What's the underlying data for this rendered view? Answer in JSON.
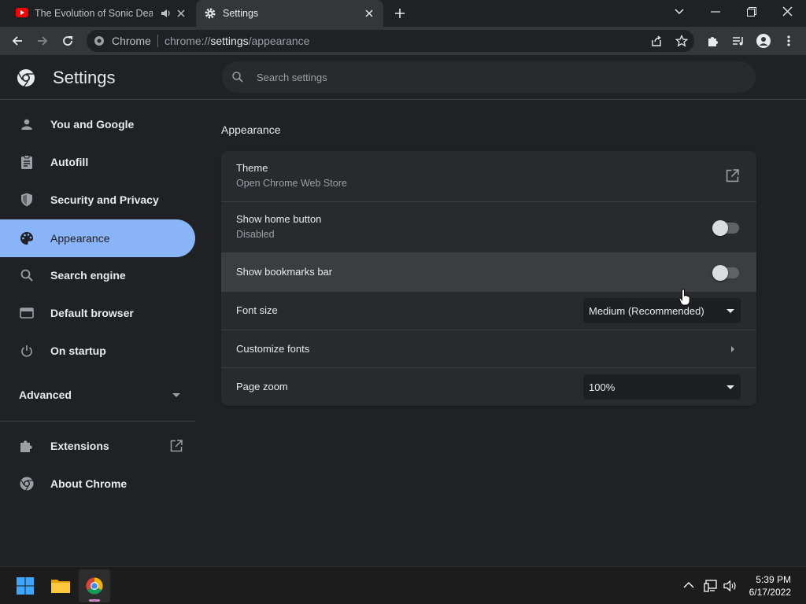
{
  "tabs": [
    {
      "title": "The Evolution of Sonic Death",
      "icon": "youtube-icon",
      "audio_icon": "speaker-icon"
    },
    {
      "title": "Settings",
      "icon": "gear-icon"
    }
  ],
  "omnibox": {
    "site_label": "Chrome",
    "url_prefix": "chrome://",
    "url_host": "settings",
    "url_path": "/appearance"
  },
  "settings": {
    "title": "Settings",
    "search_placeholder": "Search settings"
  },
  "sidebar": {
    "items": [
      {
        "label": "You and Google",
        "icon": "person-icon"
      },
      {
        "label": "Autofill",
        "icon": "clipboard-icon"
      },
      {
        "label": "Security and Privacy",
        "icon": "shield-icon"
      },
      {
        "label": "Appearance",
        "icon": "palette-icon",
        "active": true
      },
      {
        "label": "Search engine",
        "icon": "search-icon"
      },
      {
        "label": "Default browser",
        "icon": "browser-icon"
      },
      {
        "label": "On startup",
        "icon": "power-icon"
      }
    ],
    "advanced": "Advanced",
    "extensions": "Extensions",
    "about": "About Chrome"
  },
  "section": {
    "title": "Appearance",
    "theme": {
      "label": "Theme",
      "sub": "Open Chrome Web Store"
    },
    "home_button": {
      "label": "Show home button",
      "sub": "Disabled",
      "enabled": false
    },
    "bookmarks_bar": {
      "label": "Show bookmarks bar",
      "enabled": false
    },
    "font_size": {
      "label": "Font size",
      "value": "Medium (Recommended)"
    },
    "customize_fonts": {
      "label": "Customize fonts"
    },
    "page_zoom": {
      "label": "Page zoom",
      "value": "100%"
    }
  },
  "taskbar": {
    "time": "5:39 PM",
    "date": "6/17/2022"
  },
  "colors": {
    "accent": "#8ab4f8",
    "background": "#202124",
    "card": "#292a2d"
  }
}
